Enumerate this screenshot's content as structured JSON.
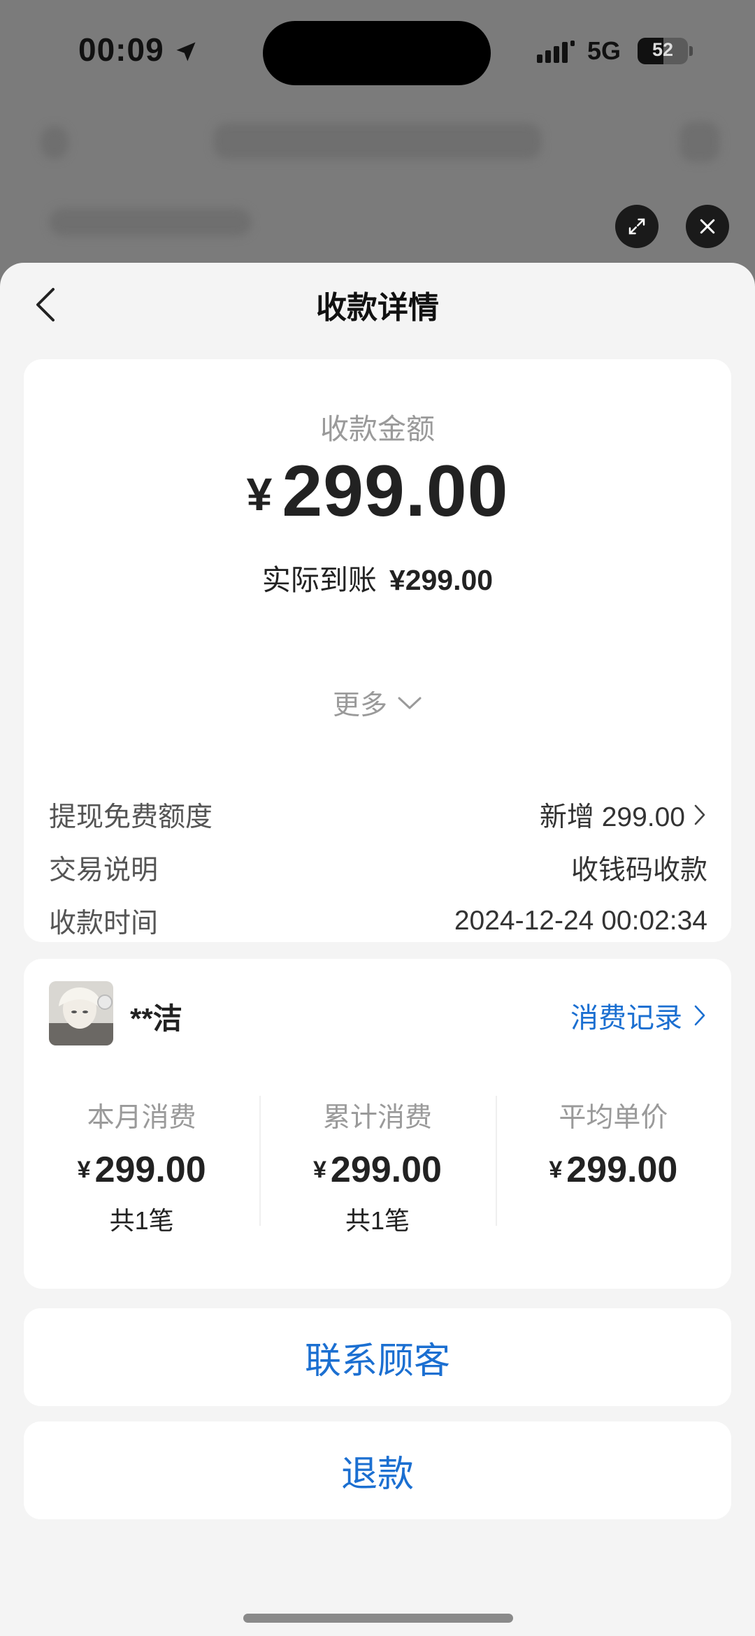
{
  "status_bar": {
    "time": "00:09",
    "network": "5G",
    "battery_level": "52",
    "battery_fraction": 0.52,
    "location_icon": "location-arrow-icon",
    "signal_icon": "cellular-signal-icon"
  },
  "overlay": {
    "expand_icon": "expand-icon",
    "close_icon": "close-icon"
  },
  "nav": {
    "back_icon": "chevron-left-icon",
    "title": "收款详情"
  },
  "summary": {
    "amount_label": "收款金额",
    "currency": "¥",
    "amount": "299.00",
    "actual_label": "实际到账",
    "actual_value": "¥299.00",
    "rows": [
      {
        "key": "提现免费额度",
        "value": "新增 299.00",
        "has_arrow": true
      },
      {
        "key": "交易说明",
        "value": "收钱码收款",
        "has_arrow": false
      },
      {
        "key": "收款时间",
        "value": "2024-12-24 00:02:34",
        "has_arrow": false
      }
    ],
    "more_label": "更多"
  },
  "customer": {
    "name": "**洁",
    "records_link": "消费记录",
    "stats": [
      {
        "label": "本月消费",
        "currency": "¥",
        "value": "299.00",
        "count": "共1笔"
      },
      {
        "label": "累计消费",
        "currency": "¥",
        "value": "299.00",
        "count": "共1笔"
      },
      {
        "label": "平均单价",
        "currency": "¥",
        "value": "299.00",
        "count": ""
      }
    ]
  },
  "actions": {
    "contact": "联系顾客",
    "refund": "退款"
  },
  "colors": {
    "accent": "#1b6fd1",
    "sheet_bg": "#f4f4f4",
    "backdrop": "#7b7b7b"
  }
}
